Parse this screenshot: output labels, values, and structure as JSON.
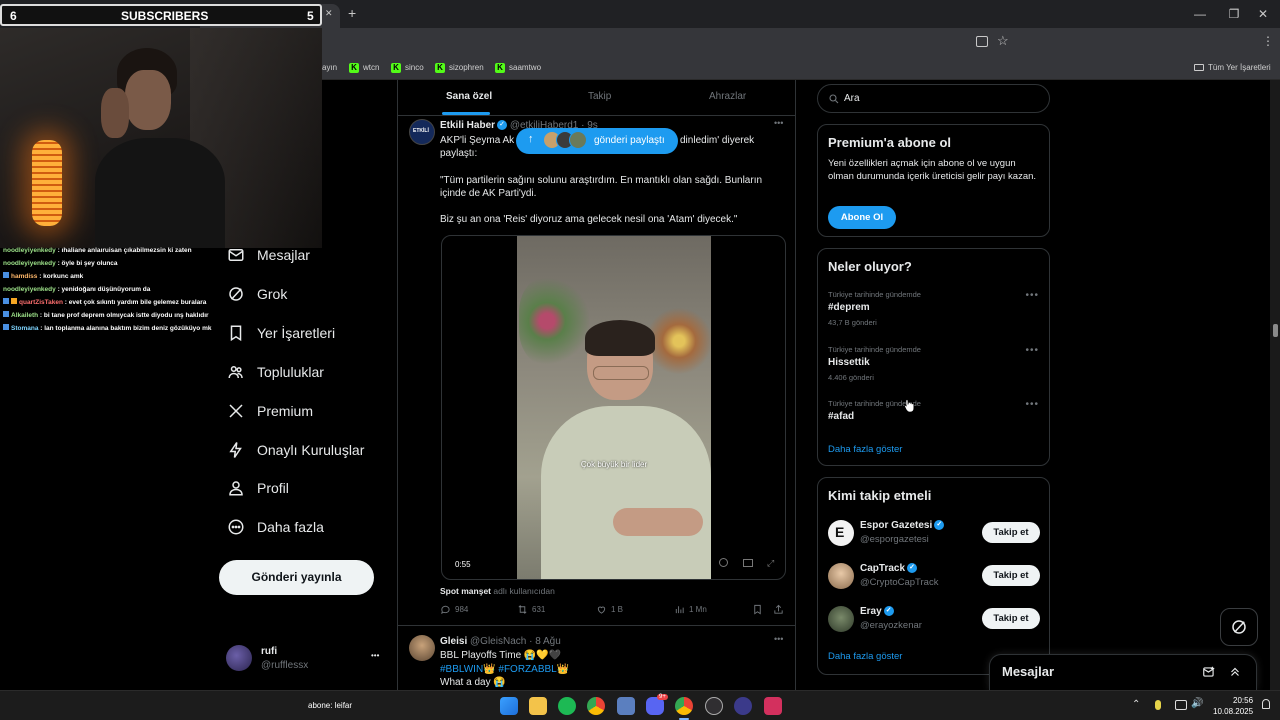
{
  "stream_overlay": {
    "subscriber_left": "6",
    "subscriber_label": "SUBSCRIBERS",
    "subscriber_right": "5",
    "chat": [
      {
        "user": "noodleyiyenkedy",
        "msg": ": ıhaliane anlaıruisan çıkabilmezsin ki zaten",
        "color": "g"
      },
      {
        "user": "noodleyiyenkedy",
        "msg": ": öyle bi şey olunca",
        "color": "g"
      },
      {
        "user": "hamdiss",
        "msg": ": korkunc amk",
        "color": "o"
      },
      {
        "user": "noodleyiyenkedy",
        "msg": ": yenidoğanı düşünüyorum da",
        "color": "g"
      },
      {
        "user": "quartZisTaken",
        "msg": ": evet çok sıkıntı yardım bile gelemez buralara",
        "color": "r"
      },
      {
        "user": "Alkaileth",
        "msg": ": bi tane prof deprem olmıycak istte diyodu ınş haklıdır",
        "color": "g"
      },
      {
        "user": "Stomana",
        "msg": ": lan toplanma alanına baktım bizim deniz gözüküyo mk",
        "color": "c"
      }
    ]
  },
  "browser": {
    "tab_close": "✕",
    "new_tab": "+",
    "window_min": "—",
    "window_max": "❐",
    "window_close": "✕",
    "bookmarks": [
      {
        "label": "ayın",
        "kick": false
      },
      {
        "label": "wtcn",
        "kick": true
      },
      {
        "label": "sinco",
        "kick": true
      },
      {
        "label": "sizophren",
        "kick": true
      },
      {
        "label": "saamtwo",
        "kick": true
      }
    ],
    "all_bookmarks": "Tüm Yer İşaretleri"
  },
  "nav": {
    "items": [
      {
        "label": "Mesajlar",
        "icon": "mail-icon"
      },
      {
        "label": "Grok",
        "icon": "grok-icon"
      },
      {
        "label": "Yer İşaretleri",
        "icon": "bookmark-icon"
      },
      {
        "label": "Topluluklar",
        "icon": "communities-icon"
      },
      {
        "label": "Premium",
        "icon": "x-logo-icon"
      },
      {
        "label": "Onaylı Kuruluşlar",
        "icon": "lightning-icon"
      },
      {
        "label": "Profil",
        "icon": "person-icon"
      },
      {
        "label": "Daha fazla",
        "icon": "more-circle-icon"
      }
    ],
    "post_button": "Gönderi yayınla",
    "account_name": "rufi",
    "account_handle": "@rufflessx",
    "account_more": "•••"
  },
  "feed": {
    "tabs": [
      "Sana özel",
      "Takip",
      "Ahrazlar"
    ],
    "share_pill": "gönderi paylaştı",
    "tweet1": {
      "author": "Etkili Haber",
      "handle_time": "@etkiliHaberd1 · 9s",
      "line1a": "AKP'li Şeyma Ak",
      "line1b": "dinledim' diyerek",
      "line2": "paylaştı:",
      "quote": "\"Tüm partilerin sağını solunu araştırdım. En mantıklı olan sağdı. Bunların içinde de AK Parti'ydi.",
      "quote2": "Biz şu an ona 'Reis' diyoruz ama gelecek nesil ona 'Atam' diyecek.\"",
      "video_subtitle": "Çok büyük bir lider",
      "video_duration": "0:55",
      "source_name": "Spot manşet",
      "source_suffix": "adlı kullanıcıdan",
      "replies": "984",
      "reposts": "631",
      "likes": "1 B",
      "views": "1 Mn"
    },
    "tweet2": {
      "author": "Gleisi",
      "handle_time": "@GleisNach · 8 Ağu",
      "line1": "BBL Playoffs Time 😭💛🖤",
      "line2": "#BBLWIN👑 #FORZABBL👑",
      "line3": "What a day 😭"
    }
  },
  "sidebar": {
    "search_placeholder": "Ara",
    "premium": {
      "title": "Premium'a abone ol",
      "body": "Yeni özellikleri açmak için abone ol ve uygun olman durumunda içerik üreticisi gelir payı kazan.",
      "button": "Abone Ol"
    },
    "trends": {
      "title": "Neler oluyor?",
      "items": [
        {
          "meta": "Türkiye tarihinde gündemde",
          "name": "#deprem",
          "count": "43,7 B gönderi"
        },
        {
          "meta": "Türkiye tarihinde gündemde",
          "name": "Hissettik",
          "count": "4.406 gönderi"
        },
        {
          "meta": "Türkiye tarihinde gündemde",
          "name": "#afad",
          "count": ""
        }
      ],
      "show_more": "Daha fazla göster"
    },
    "follow": {
      "title": "Kimi takip etmeli",
      "items": [
        {
          "name": "Espor Gazetesi",
          "handle": "@esporgazetesi",
          "button": "Takip et"
        },
        {
          "name": "CapTrack",
          "handle": "@CryptoCapTrack",
          "button": "Takip et"
        },
        {
          "name": "Eray",
          "handle": "@erayozkenar",
          "button": "Takip et"
        }
      ],
      "show_more": "Daha fazla göster"
    },
    "messages_drawer": "Mesajlar"
  },
  "taskbar": {
    "left_text": "abone: leifar",
    "time": "20:56",
    "date": "10.08.2025",
    "discord_badge": "9+"
  },
  "colors": {
    "accent": "#1d9bf0",
    "background": "#000000",
    "border": "#2f3336",
    "muted": "#71767b"
  }
}
